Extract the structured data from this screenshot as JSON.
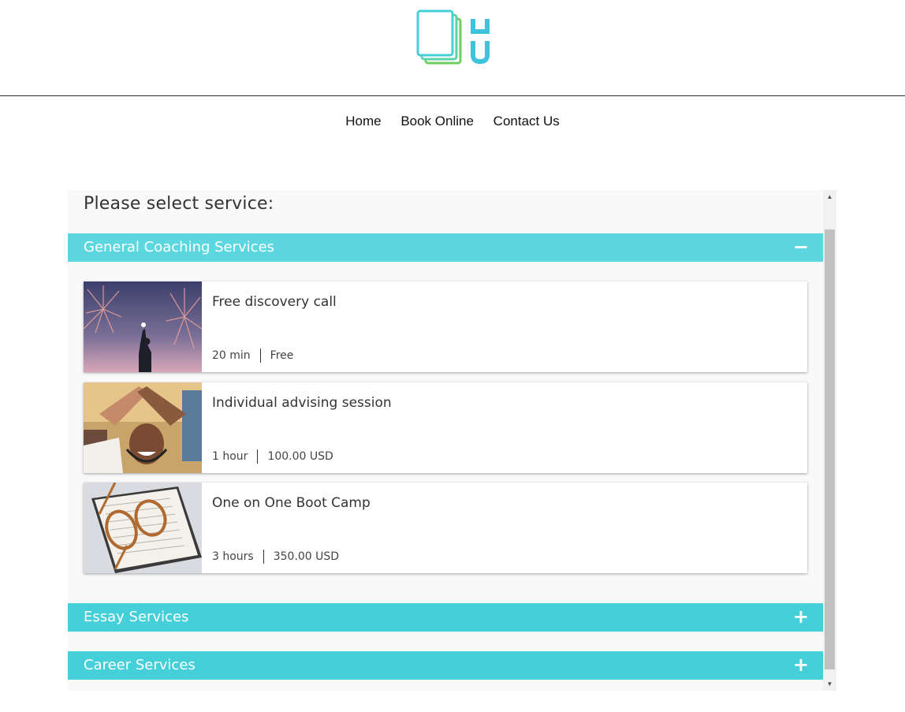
{
  "logo": {
    "icon": "book-stack-logo",
    "letters": "LU",
    "colors": [
      "#5ad4a8",
      "#6ccf5e",
      "#3ec3de"
    ]
  },
  "nav": {
    "items": [
      "Home",
      "Book Online",
      "Contact Us"
    ]
  },
  "widget": {
    "title": "Please select service:",
    "categories": [
      {
        "label": "General Coaching Services",
        "toggle": "−",
        "expanded": true,
        "services": [
          {
            "name": "Free discovery call",
            "duration": "20 min",
            "price": "Free",
            "image": "fireworks-person-photo"
          },
          {
            "name": "Individual advising session",
            "duration": "1 hour",
            "price": "100.00 USD",
            "image": "high-five-photo"
          },
          {
            "name": "One on One Boot Camp",
            "duration": "3 hours",
            "price": "350.00 USD",
            "image": "glasses-on-book-photo"
          }
        ]
      },
      {
        "label": "Essay Services",
        "toggle": "+",
        "expanded": false
      },
      {
        "label": "Career Services",
        "toggle": "+",
        "expanded": false
      }
    ],
    "accent_color": "#45cfd9"
  }
}
